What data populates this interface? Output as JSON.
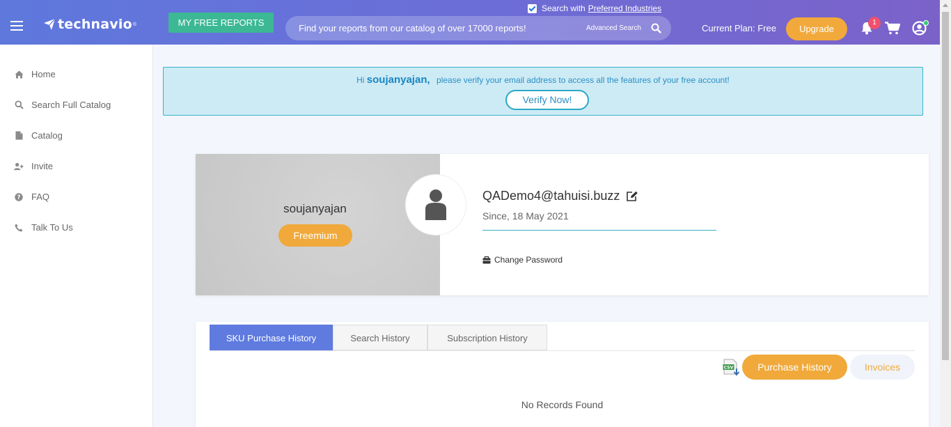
{
  "header": {
    "logo_text": "technavio",
    "logo_mark": "®",
    "free_reports_label": "MY FREE REPORTS",
    "search_pref_label": "Search with",
    "search_pref_link": "Preferred Industries",
    "search_pref_checked": true,
    "search_placeholder": "Find your reports from our catalog of over 17000 reports!",
    "advanced_search_label": "Advanced Search",
    "plan_label": "Current Plan: Free",
    "upgrade_label": "Upgrade",
    "notification_count": "1",
    "icons": [
      "menu-icon",
      "search-icon",
      "bell-icon",
      "cart-icon",
      "user-circle-icon"
    ]
  },
  "sidebar": {
    "items": [
      {
        "label": "Home",
        "icon": "home-icon"
      },
      {
        "label": "Search Full Catalog",
        "icon": "search-icon"
      },
      {
        "label": "Catalog",
        "icon": "file-icon"
      },
      {
        "label": "Invite",
        "icon": "user-plus-icon"
      },
      {
        "label": "FAQ",
        "icon": "question-circle-icon"
      },
      {
        "label": "Talk To Us",
        "icon": "phone-icon"
      }
    ]
  },
  "alert": {
    "greeting": "Hi",
    "username": "soujanyajan,",
    "message": "please verify your email address to access all the features of your free account!",
    "verify_label": "Verify Now!"
  },
  "profile": {
    "username": "soujanyajan",
    "tier": "Freemium",
    "email": "QADemo4@tahuisi.buzz",
    "since": "Since, 18 May 2021",
    "change_password_label": "Change Password"
  },
  "history": {
    "tabs": [
      {
        "label": "SKU Purchase History",
        "active": true
      },
      {
        "label": "Search History",
        "active": false
      },
      {
        "label": "Subscription History",
        "active": false
      }
    ],
    "csv_label": "CSV",
    "purchase_history_label": "Purchase History",
    "invoices_label": "Invoices",
    "empty_message": "No Records Found"
  },
  "colors": {
    "header_start": "#5e78dc",
    "header_end": "#7b62c9",
    "accent_orange": "#f0a93a",
    "accent_green": "#3cb894",
    "alert_bg": "#cdebf5",
    "alert_border": "#32b3c7",
    "active_tab": "#5f7be0"
  }
}
